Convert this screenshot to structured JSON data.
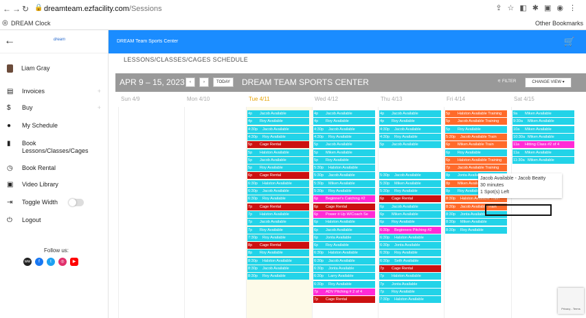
{
  "browser": {
    "url_domain": "dreamteam.ezfacility.com",
    "url_path": "/Sessions",
    "bookmark": "DREAM Clock",
    "other_bookmarks": "Other Bookmarks"
  },
  "sidebar": {
    "logo_text": "dream",
    "user": "Liam Gray",
    "items": [
      {
        "icon": "invoice-icon",
        "glyph": "▤",
        "label": "Invoices",
        "plus": true
      },
      {
        "icon": "dollar-icon",
        "glyph": "$",
        "label": "Buy",
        "plus": true
      },
      {
        "icon": "person-icon",
        "glyph": "●",
        "label": "My Schedule",
        "plus": false
      },
      {
        "icon": "book-icon",
        "glyph": "▮",
        "label": "Book Lessons/Classes/Cages",
        "plus": false
      },
      {
        "icon": "clock-icon",
        "glyph": "◷",
        "label": "Book Rental",
        "plus": false
      },
      {
        "icon": "video-icon",
        "glyph": "▣",
        "label": "Video Library",
        "plus": false
      },
      {
        "icon": "width-icon",
        "glyph": "⇥",
        "label": "Toggle Width",
        "plus": false
      },
      {
        "icon": "logout-icon",
        "glyph": "⏻",
        "label": "Logout",
        "plus": false
      }
    ],
    "follow_us": "Follow us:"
  },
  "header": {
    "title": "DREAM Team Sports Center",
    "breadcrumb": "LESSONS/CLASSES/CAGES SCHEDULE"
  },
  "calendar": {
    "range": "APR 9 – 15, 2023",
    "today_btn": "TODAY",
    "prev": "‹",
    "next": "›",
    "center_name": "DREAM TEAM SPORTS CENTER",
    "filter": "FILTER",
    "change_view": "CHANGE VIEW ▾",
    "days": [
      "Sun 4/9",
      "Mon 4/10",
      "Tue 4/11",
      "Wed 4/12",
      "Thu 4/13",
      "Fri 4/14",
      "Sat 4/15"
    ],
    "today_index": 2
  },
  "colors": {
    "available": "#22d3e8",
    "rental": "#cc1111",
    "training": "#ff6a2a",
    "class": "#ff2bd6"
  },
  "events": {
    "tue": [
      [
        "4p",
        "Jacob Available",
        "available"
      ],
      [
        "4p",
        "Roy Available",
        "available"
      ],
      [
        "4:30p",
        "Jacob Available",
        "available"
      ],
      [
        "4:30p",
        "Roy Available",
        "available"
      ],
      [
        "5p",
        "Cage Rental",
        "rental"
      ],
      [
        "5p",
        "Halston Available",
        "available"
      ],
      [
        "5p",
        "Jacob Available",
        "available"
      ],
      [
        "5p",
        "Roy Available",
        "available"
      ],
      [
        "6p",
        "Cage Rental",
        "rental"
      ],
      [
        "6:30p",
        "Halston Available",
        "available"
      ],
      [
        "6:30p",
        "Jacob Available",
        "available"
      ],
      [
        "6:30p",
        "Roy Available",
        "available"
      ],
      [
        "7p",
        "Cage Rental",
        "rental"
      ],
      [
        "7p",
        "Halston Available",
        "available"
      ],
      [
        "7p",
        "Jacob Available",
        "available"
      ],
      [
        "7p",
        "Roy Available",
        "available"
      ],
      [
        "7:30p",
        "Roy Available",
        "available"
      ],
      [
        "8p",
        "Cage Rental",
        "rental"
      ],
      [
        "8p",
        "Roy Available",
        "available"
      ],
      [
        "8:30p",
        "Halston Available",
        "available"
      ],
      [
        "8:30p",
        "Jacob Available",
        "available"
      ],
      [
        "8:30p",
        "Roy Available",
        "available"
      ]
    ],
    "wed": [
      [
        "4p",
        "Jacob Available",
        "available"
      ],
      [
        "4p",
        "Roy Available",
        "available"
      ],
      [
        "4:30p",
        "Jacob Available",
        "available"
      ],
      [
        "4:30p",
        "Roy Available",
        "available"
      ],
      [
        "5p",
        "Jacob Available",
        "available"
      ],
      [
        "5p",
        "Miken Available",
        "available"
      ],
      [
        "5p",
        "Roy Available",
        "available"
      ],
      [
        "5:30p",
        "Halston Available",
        "available"
      ],
      [
        "5:30p",
        "Jacob Available",
        "available"
      ],
      [
        "5:30p",
        "Miken Available",
        "available"
      ],
      [
        "5:30p",
        "Roy Available",
        "available"
      ],
      [
        "6p",
        "Beginner's Catching #2",
        "class"
      ],
      [
        "6p",
        "Cage Rental",
        "rental"
      ],
      [
        "6p",
        "Power it Up W/Coach Se",
        "class"
      ],
      [
        "6p",
        "Halston Available",
        "available"
      ],
      [
        "6p",
        "Jacob Available",
        "available"
      ],
      [
        "6p",
        "Jonta Available",
        "available"
      ],
      [
        "6p",
        "Roy Available",
        "available"
      ],
      [
        "6:30p",
        "Halston Available",
        "available"
      ],
      [
        "6:30p",
        "Jacob Available",
        "available"
      ],
      [
        "6:30p",
        "Jonta Available",
        "available"
      ],
      [
        "6:30p",
        "Larry Available",
        "available"
      ],
      [
        "6:30p",
        "Roy Available",
        "available"
      ],
      [
        "7p",
        "ADV Pitching # 2 of 4",
        "class"
      ],
      [
        "7p",
        "Cage Rental",
        "rental"
      ]
    ],
    "thu": [
      [
        "4p",
        "Jacob Available",
        "available"
      ],
      [
        "4p",
        "Roy Available",
        "available"
      ],
      [
        "4:30p",
        "Jacob Available",
        "available"
      ],
      [
        "4:30p",
        "Roy Available",
        "available"
      ],
      [
        "5p",
        "Jacob Available",
        "available"
      ],
      [
        "",
        "",
        ""
      ],
      [
        "",
        "",
        ""
      ],
      [
        "",
        "",
        ""
      ],
      [
        "5:30p",
        "Jacob Available",
        "available"
      ],
      [
        "5:30p",
        "Miken Available",
        "available"
      ],
      [
        "5:30p",
        "Roy Available",
        "available"
      ],
      [
        "6p",
        "Cage Rental",
        "rental"
      ],
      [
        "6p",
        "Jacob Available",
        "available"
      ],
      [
        "6p",
        "Miken Available",
        "available"
      ],
      [
        "6p",
        "Roy Available",
        "available"
      ],
      [
        "6:30p",
        "Beginners Pitching #2",
        "class"
      ],
      [
        "6:30p",
        "Halston Available",
        "available"
      ],
      [
        "6:30p",
        "Jonta Available",
        "available"
      ],
      [
        "6:30p",
        "Roy Available",
        "available"
      ],
      [
        "6:30p",
        "Seth Available",
        "available"
      ],
      [
        "7p",
        "Cage Rental",
        "rental"
      ],
      [
        "7p",
        "Halston Available",
        "available"
      ],
      [
        "7p",
        "Jonta Available",
        "available"
      ],
      [
        "7p",
        "Roy Available",
        "available"
      ],
      [
        "7:30p",
        "Halston Available",
        "available"
      ]
    ],
    "fri": [
      [
        "5p",
        "Halston Available Training",
        "training"
      ],
      [
        "5p",
        "Jacob Available Training",
        "training"
      ],
      [
        "5p",
        "Roy Available",
        "available"
      ],
      [
        "5:30p",
        "Jacob Available Train",
        "training"
      ],
      [
        "6p",
        "Miken Available Train",
        "training"
      ],
      [
        "6p",
        "Roy Available",
        "available"
      ],
      [
        "6p",
        "Halston Available Training",
        "training"
      ],
      [
        "7p",
        "Jacob Available Training",
        "training"
      ],
      [
        "8p",
        "Jonta Available",
        "available"
      ],
      [
        "8p",
        "Miken Available Training",
        "training"
      ],
      [
        "8p",
        "Roy Available",
        "available"
      ],
      [
        "8:30p",
        "Halston Available Train",
        "training"
      ],
      [
        "8:30p",
        "Jacob Available Train",
        "training"
      ],
      [
        "8:30p",
        "Jonta Available",
        "available"
      ],
      [
        "8:30p",
        "Miken Available",
        "available"
      ],
      [
        "8:30p",
        "Roy Available",
        "available"
      ]
    ],
    "sat": [
      [
        "9a",
        "Miken Available",
        "available"
      ],
      [
        "9:30a",
        "Miken Available",
        "available"
      ],
      [
        "10a",
        "Miken Available",
        "available"
      ],
      [
        "10:30a",
        "Miken Available",
        "available"
      ],
      [
        "11a",
        "Hitting Class #2 of 4",
        "class"
      ],
      [
        "11a",
        "Miken Available",
        "available"
      ],
      [
        "11:30a",
        "Miken Available",
        "available"
      ]
    ]
  },
  "tooltip": {
    "line1": "Jacob Available - Jacob Beatty",
    "line2": "30 minutes",
    "line3": "1 Spot(s) Left"
  },
  "captcha": "Privacy - Terms"
}
